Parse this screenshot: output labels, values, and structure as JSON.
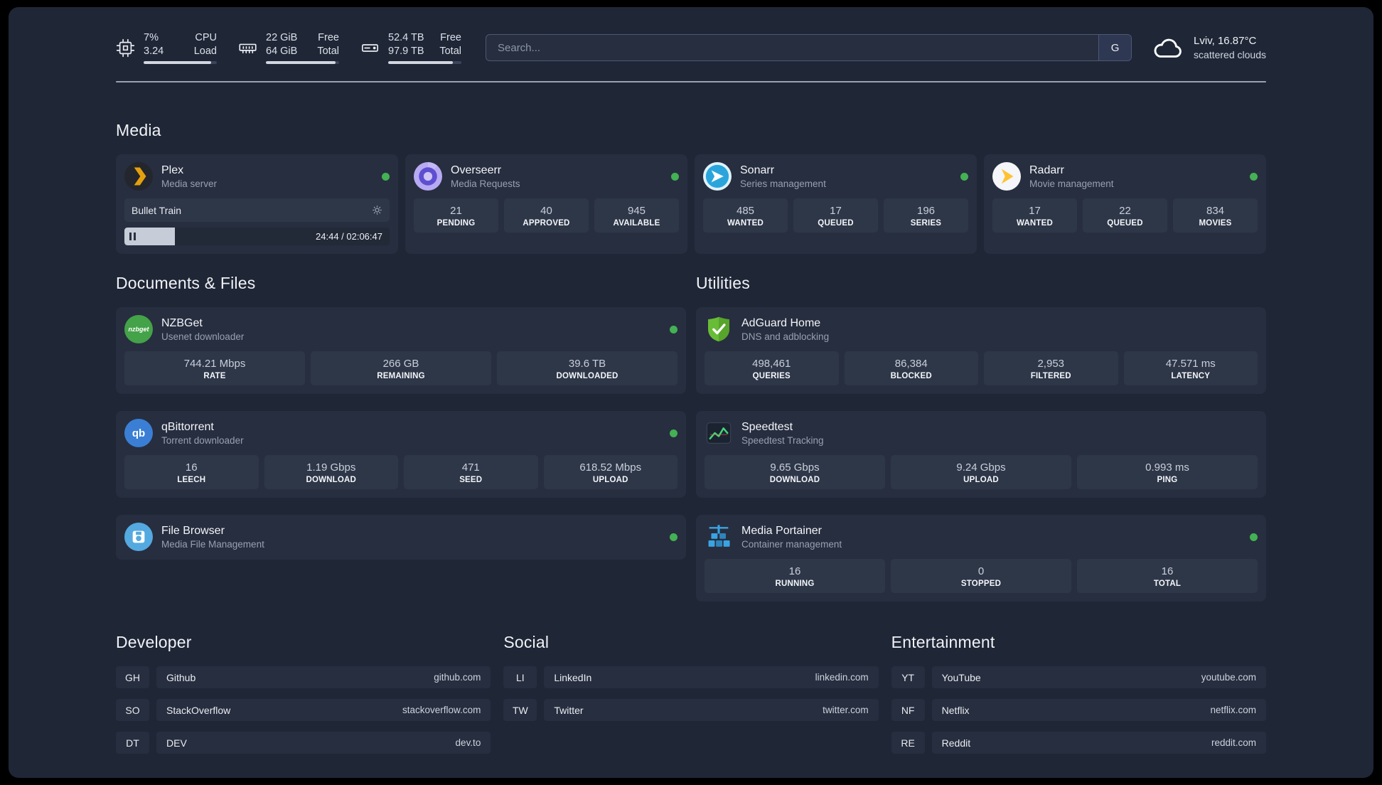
{
  "colors": {
    "bg": "#1f2636",
    "card": "#272e3f",
    "tile": "#2e3748",
    "status-green": "#43b154",
    "plex-gold": "#e5a00d"
  },
  "topbar": {
    "cpu": {
      "values": [
        "7%",
        "3.24"
      ],
      "labels": [
        "CPU",
        "Load"
      ],
      "bar_percent": 92
    },
    "ram": {
      "values": [
        "22 GiB",
        "64 GiB"
      ],
      "labels": [
        "Free",
        "Total"
      ],
      "bar_percent": 95
    },
    "disk": {
      "values": [
        "52.4 TB",
        "97.9 TB"
      ],
      "labels": [
        "Free",
        "Total"
      ],
      "bar_percent": 88
    },
    "search": {
      "placeholder": "Search...",
      "button": "G"
    },
    "weather": {
      "location": "Lviv, 16.87°C",
      "condition": "scattered clouds"
    }
  },
  "media": {
    "heading": "Media",
    "plex": {
      "name": "Plex",
      "desc": "Media server",
      "now_playing": "Bullet Train",
      "progress_percent": 19,
      "time": "24:44 / 02:06:47"
    },
    "overseerr": {
      "name": "Overseerr",
      "desc": "Media Requests",
      "stats": [
        {
          "value": "21",
          "label": "PENDING"
        },
        {
          "value": "40",
          "label": "APPROVED"
        },
        {
          "value": "945",
          "label": "AVAILABLE"
        }
      ]
    },
    "sonarr": {
      "name": "Sonarr",
      "desc": "Series management",
      "stats": [
        {
          "value": "485",
          "label": "WANTED"
        },
        {
          "value": "17",
          "label": "QUEUED"
        },
        {
          "value": "196",
          "label": "SERIES"
        }
      ]
    },
    "radarr": {
      "name": "Radarr",
      "desc": "Movie management",
      "stats": [
        {
          "value": "17",
          "label": "WANTED"
        },
        {
          "value": "22",
          "label": "QUEUED"
        },
        {
          "value": "834",
          "label": "MOVIES"
        }
      ]
    }
  },
  "documents": {
    "heading": "Documents & Files",
    "nzbget": {
      "name": "NZBGet",
      "desc": "Usenet downloader",
      "icon_text": "nzbget",
      "stats": [
        {
          "value": "744.21 Mbps",
          "label": "RATE"
        },
        {
          "value": "266 GB",
          "label": "REMAINING"
        },
        {
          "value": "39.6 TB",
          "label": "DOWNLOADED"
        }
      ]
    },
    "qbittorrent": {
      "name": "qBittorrent",
      "desc": "Torrent downloader",
      "icon_text": "qb",
      "stats": [
        {
          "value": "16",
          "label": "LEECH"
        },
        {
          "value": "1.19 Gbps",
          "label": "DOWNLOAD"
        },
        {
          "value": "471",
          "label": "SEED"
        },
        {
          "value": "618.52 Mbps",
          "label": "UPLOAD"
        }
      ]
    },
    "filebrowser": {
      "name": "File Browser",
      "desc": "Media File Management"
    }
  },
  "utilities": {
    "heading": "Utilities",
    "adguard": {
      "name": "AdGuard Home",
      "desc": "DNS and adblocking",
      "stats": [
        {
          "value": "498,461",
          "label": "QUERIES"
        },
        {
          "value": "86,384",
          "label": "BLOCKED"
        },
        {
          "value": "2,953",
          "label": "FILTERED"
        },
        {
          "value": "47.571 ms",
          "label": "LATENCY"
        }
      ]
    },
    "speedtest": {
      "name": "Speedtest",
      "desc": "Speedtest Tracking",
      "stats": [
        {
          "value": "9.65 Gbps",
          "label": "DOWNLOAD"
        },
        {
          "value": "9.24 Gbps",
          "label": "UPLOAD"
        },
        {
          "value": "0.993 ms",
          "label": "PING"
        }
      ]
    },
    "portainer": {
      "name": "Media Portainer",
      "desc": "Container management",
      "stats": [
        {
          "value": "16",
          "label": "RUNNING"
        },
        {
          "value": "0",
          "label": "STOPPED"
        },
        {
          "value": "16",
          "label": "TOTAL"
        }
      ]
    }
  },
  "bookmarks": {
    "developer": {
      "heading": "Developer",
      "items": [
        {
          "abbr": "GH",
          "name": "Github",
          "url": "github.com"
        },
        {
          "abbr": "SO",
          "name": "StackOverflow",
          "url": "stackoverflow.com"
        },
        {
          "abbr": "DT",
          "name": "DEV",
          "url": "dev.to"
        }
      ]
    },
    "social": {
      "heading": "Social",
      "items": [
        {
          "abbr": "LI",
          "name": "LinkedIn",
          "url": "linkedin.com"
        },
        {
          "abbr": "TW",
          "name": "Twitter",
          "url": "twitter.com"
        }
      ]
    },
    "entertainment": {
      "heading": "Entertainment",
      "items": [
        {
          "abbr": "YT",
          "name": "YouTube",
          "url": "youtube.com"
        },
        {
          "abbr": "NF",
          "name": "Netflix",
          "url": "netflix.com"
        },
        {
          "abbr": "RE",
          "name": "Reddit",
          "url": "reddit.com"
        }
      ]
    }
  }
}
